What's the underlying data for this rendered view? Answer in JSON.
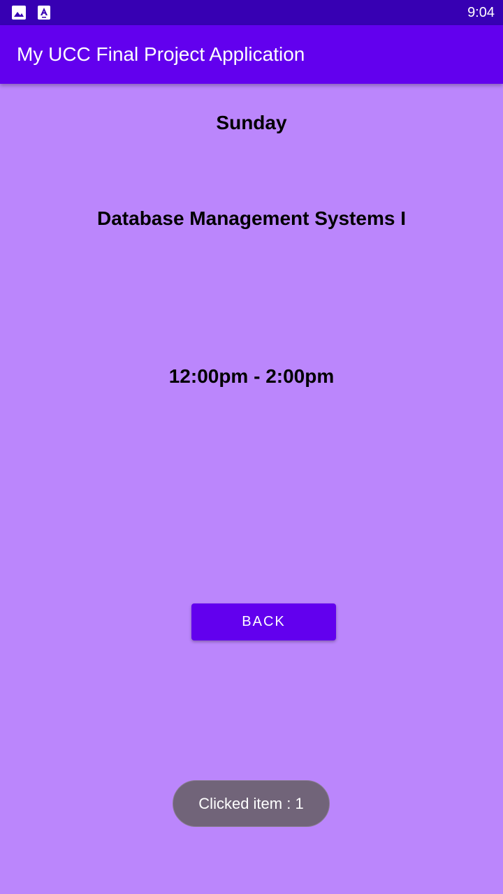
{
  "status_bar": {
    "time": "9:04",
    "icons": [
      "image-icon",
      "accessibility-app-icon"
    ],
    "background_color": "#3700b3"
  },
  "app_bar": {
    "title": "My UCC Final Project Application",
    "background_color": "#6200ee"
  },
  "content": {
    "day": "Sunday",
    "course": "Database Management Systems I",
    "time": "12:00pm - 2:00pm",
    "background_color": "#bb86fc"
  },
  "actions": {
    "back_label": "BACK"
  },
  "toast": {
    "message": "Clicked item : 1"
  }
}
